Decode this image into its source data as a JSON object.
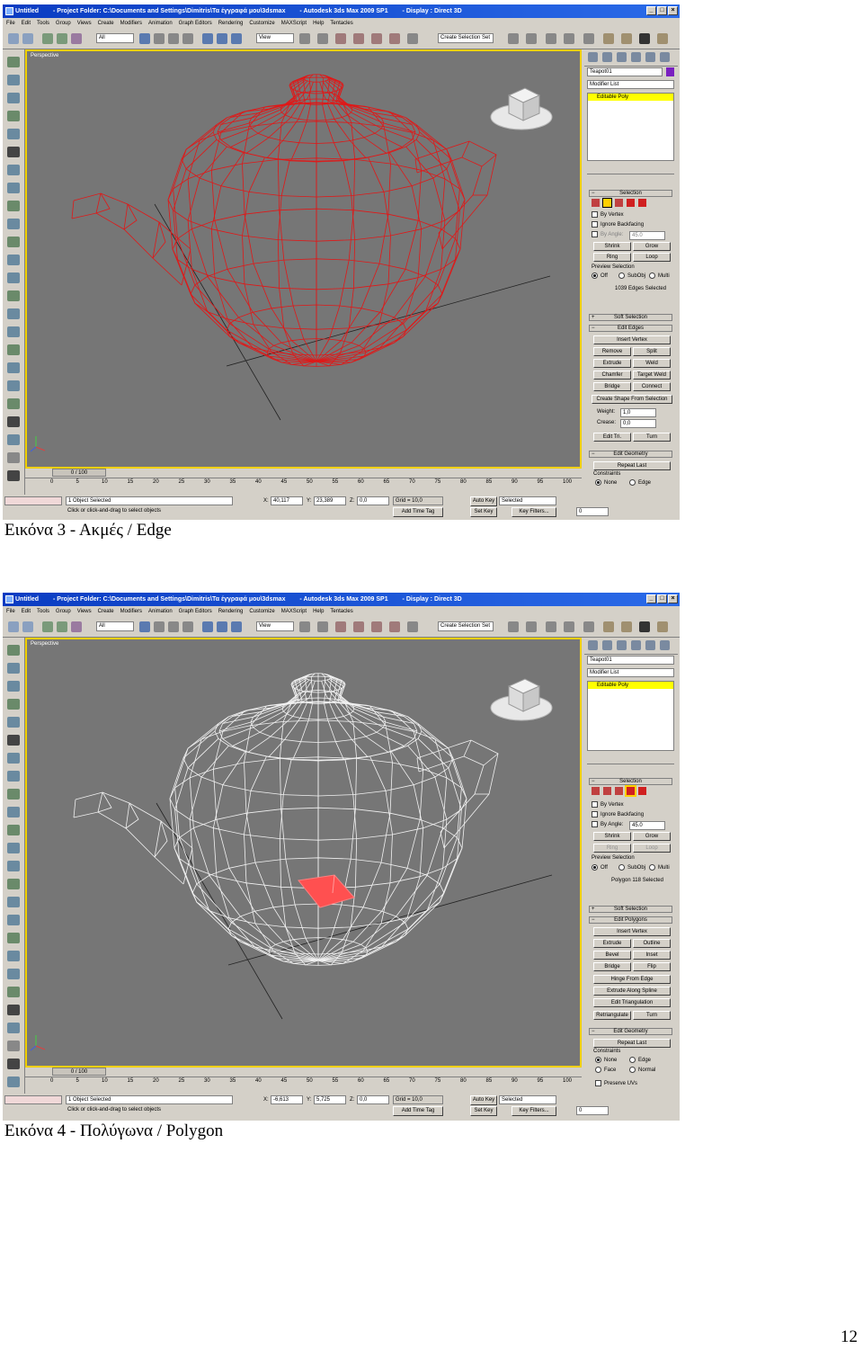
{
  "figures": [
    {
      "caption": "Εικόνα 3 - Ακμές / Edge",
      "title_parts": [
        "Untitled",
        "- Project Folder: C:\\Documents and Settings\\Dimitris\\Τα έγγραφά μου\\3dsmax",
        "- Autodesk 3ds Max  2009 SP1",
        "- Display : Direct 3D"
      ],
      "menu": [
        "File",
        "Edit",
        "Tools",
        "Group",
        "Views",
        "Create",
        "Modifiers",
        "Animation",
        "Graph Editors",
        "Rendering",
        "Customize",
        "MAXScript",
        "Help",
        "Tentacles"
      ],
      "toolbar": {
        "filter": "All",
        "refcoord": "View",
        "selset": "Create Selection Set"
      },
      "viewport_label": "Perspective",
      "wire_color": "#e01818",
      "selected_polygon": false,
      "cmd": {
        "object_name": "Teapot01",
        "modifier_list": "Modifier List",
        "stack_item": "Editable Poly",
        "selection_title": "Selection",
        "by_vertex": "By Vertex",
        "ignore_backfacing": "Ignore Backfacing",
        "by_angle": "By Angle:",
        "angle_value": "45.0",
        "shrink": "Shrink",
        "grow": "Grow",
        "ring": "Ring",
        "loop": "Loop",
        "preview_selection": "Preview Selection",
        "off": "Off",
        "subobj": "SubObj",
        "multi": "Multi",
        "selected_count": "1039 Edges Selected",
        "soft_selection": "Soft Selection",
        "edit_title": "Edit Edges",
        "buttons": [
          [
            "Insert Vertex"
          ],
          [
            "Remove",
            "Split"
          ],
          [
            "Extrude",
            "Weld"
          ],
          [
            "Chamfer",
            "Target Weld"
          ],
          [
            "Bridge",
            "Connect"
          ],
          [
            "Create Shape From Selection"
          ]
        ],
        "weight_label": "Weight:",
        "weight_value": "1,0",
        "crease_label": "Crease:",
        "crease_value": "0,0",
        "edit_tri": "Edit Tri.",
        "turn": "Turn",
        "edit_geometry": "Edit Geometry",
        "repeat_last": "Repeat Last",
        "constraints": "Constraints",
        "none": "None",
        "edge": "Edge"
      },
      "timeline": {
        "slider": "0 / 100",
        "ticks": [
          "0",
          "5",
          "10",
          "15",
          "20",
          "25",
          "30",
          "35",
          "40",
          "45",
          "50",
          "55",
          "60",
          "65",
          "70",
          "75",
          "80",
          "85",
          "90",
          "95",
          "100"
        ]
      },
      "status": {
        "selected": "1 Object Selected",
        "prompt": "Click or click-and-drag to select objects",
        "x_label": "X:",
        "x": "40,117",
        "y_label": "Y:",
        "y": "23,389",
        "z_label": "Z:",
        "z": "0,0",
        "grid": "Grid = 10,0",
        "add_time_tag": "Add Time Tag",
        "auto_key": "Auto Key",
        "set_key": "Set Key",
        "key_mode": "Selected",
        "key_filters": "Key Filters...",
        "frame": "0"
      }
    },
    {
      "caption": "Εικόνα 4 - Πολύγωνα / Polygon",
      "title_parts": [
        "Untitled",
        "- Project Folder: C:\\Documents and Settings\\Dimitris\\Τα έγγραφά μου\\3dsmax",
        "- Autodesk 3ds Max  2009 SP1",
        "- Display : Direct 3D"
      ],
      "menu": [
        "File",
        "Edit",
        "Tools",
        "Group",
        "Views",
        "Create",
        "Modifiers",
        "Animation",
        "Graph Editors",
        "Rendering",
        "Customize",
        "MAXScript",
        "Help",
        "Tentacles"
      ],
      "toolbar": {
        "filter": "All",
        "refcoord": "View",
        "selset": "Create Selection Set"
      },
      "viewport_label": "Perspective",
      "wire_color": "#f2f2f2",
      "selected_polygon": true,
      "cmd": {
        "object_name": "Teapot01",
        "modifier_list": "Modifier List",
        "stack_item": "Editable Poly",
        "selection_title": "Selection",
        "by_vertex": "By Vertex",
        "ignore_backfacing": "Ignore Backfacing",
        "by_angle": "By Angle:",
        "angle_value": "45.0",
        "shrink": "Shrink",
        "grow": "Grow",
        "ring": "Ring",
        "loop": "Loop",
        "preview_selection": "Preview Selection",
        "off": "Off",
        "subobj": "SubObj",
        "multi": "Multi",
        "selected_count": "Polygon 118 Selected",
        "soft_selection": "Soft Selection",
        "edit_title": "Edit Polygons",
        "buttons": [
          [
            "Insert Vertex"
          ],
          [
            "Extrude",
            "Outline"
          ],
          [
            "Bevel",
            "Inset"
          ],
          [
            "Bridge",
            "Flip"
          ],
          [
            "Hinge From Edge"
          ],
          [
            "Extrude Along Spline"
          ],
          [
            "Edit Triangulation"
          ],
          [
            "Retriangulate",
            "Turn"
          ]
        ],
        "edit_geometry": "Edit Geometry",
        "repeat_last": "Repeat Last",
        "constraints": "Constraints",
        "none": "None",
        "edge": "Edge",
        "face": "Face",
        "normal": "Normal",
        "preserve_uvs": "Preserve UVs"
      },
      "timeline": {
        "slider": "0 / 100",
        "ticks": [
          "0",
          "5",
          "10",
          "15",
          "20",
          "25",
          "30",
          "35",
          "40",
          "45",
          "50",
          "55",
          "60",
          "65",
          "70",
          "75",
          "80",
          "85",
          "90",
          "95",
          "100"
        ]
      },
      "status": {
        "selected": "1 Object Selected",
        "prompt": "Click or click-and-drag to select objects",
        "x_label": "X:",
        "x": "-6,613",
        "y_label": "Y:",
        "y": "5,725",
        "z_label": "Z:",
        "z": "0,0",
        "grid": "Grid = 10,0",
        "add_time_tag": "Add Time Tag",
        "auto_key": "Auto Key",
        "set_key": "Set Key",
        "key_mode": "Selected",
        "key_filters": "Key Filters...",
        "frame": "0"
      }
    }
  ],
  "page_number": "12"
}
